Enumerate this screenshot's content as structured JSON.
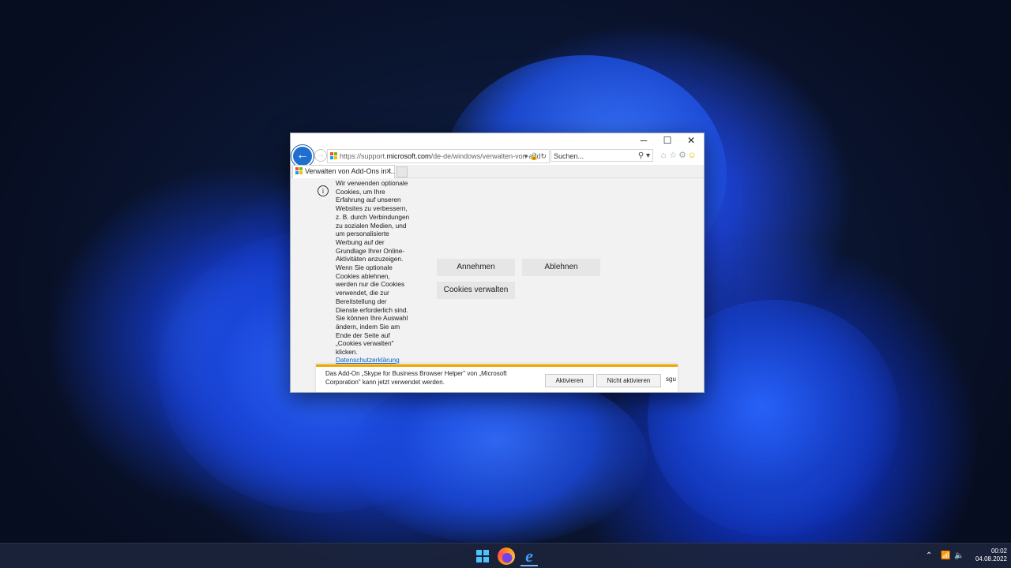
{
  "browser": {
    "title_controls": {
      "minimize": "─",
      "maximize": "☐",
      "close": "✕"
    },
    "address": {
      "url_prefix": "https://support.",
      "url_domain": "microsoft.com",
      "url_path": "/de-de/windows/verwalten-von-add"
    },
    "search": {
      "placeholder": "Suchen..."
    },
    "tab": {
      "title": "Verwalten von Add-Ons in I...",
      "close": "✕"
    }
  },
  "cookie_banner": {
    "lines": [
      "Wir verwenden optionale",
      "Cookies, um Ihre",
      "Erfahrung auf unseren",
      "Websites zu verbessern,",
      "z. B. durch Verbindungen",
      "zu sozialen Medien, und",
      "um personalisierte",
      "Werbung auf der",
      "Grundlage Ihrer Online-",
      "Aktivitäten anzuzeigen.",
      "Wenn Sie optionale",
      "Cookies ablehnen,",
      "werden nur die Cookies",
      "verwendet, die zur",
      "Bereitstellung der",
      "Dienste erforderlich sind.",
      "Sie können Ihre Auswahl",
      "ändern, indem Sie am",
      "Ende der Seite auf",
      "„Cookies verwalten\"",
      "klicken."
    ],
    "privacy_link": "Datenschutzerklärung",
    "accept": "Annehmen",
    "reject": "Ablehnen",
    "manage": "Cookies verwalten"
  },
  "notification": {
    "line1": "Das Add-On „Skype for Business Browser Helper\" von „Microsoft",
    "line2": "Corporation\" kann jetzt verwendet werden.",
    "activate": "Aktivieren",
    "deactivate": "Nicht aktivieren",
    "more": "sgu"
  },
  "taskbar": {
    "time": "00:02",
    "date": "04.08.2022"
  }
}
